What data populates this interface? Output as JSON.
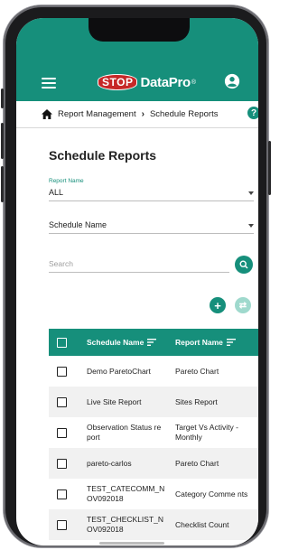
{
  "app": {
    "logo_stop": "STOP",
    "logo_text": "DataPro",
    "logo_reg": "®"
  },
  "breadcrumb": {
    "parent": "Report Management",
    "current": "Schedule Reports",
    "help": "?"
  },
  "page": {
    "title": "Schedule Reports"
  },
  "filters": {
    "report_name_label": "Report Name",
    "report_name_value": "ALL",
    "schedule_name_value": "Schedule Name",
    "search_placeholder": "Search"
  },
  "actions": {
    "add": "+",
    "swap": "⇄"
  },
  "table": {
    "headers": [
      "Schedule Name",
      "Report Name"
    ],
    "rows": [
      {
        "schedule": "Demo ParetoChart",
        "report": "Pareto Chart"
      },
      {
        "schedule": "Live Site Report",
        "report": "Sites Report"
      },
      {
        "schedule": "Observation Status re port",
        "report": "Target Vs Activity - Monthly"
      },
      {
        "schedule": "pareto-carlos",
        "report": "Pareto Chart"
      },
      {
        "schedule": "TEST_CATECOMM_N OV092018",
        "report": "Category Comme nts"
      },
      {
        "schedule": "TEST_CHECKLIST_N OV092018",
        "report": "Checklist Count"
      }
    ]
  },
  "colors": {
    "primary": "#168f7b",
    "accent_red": "#c62828"
  },
  "icons": [
    "menu-icon",
    "account-icon",
    "home-icon",
    "chevron-right-icon",
    "help-icon",
    "search-icon",
    "add-icon",
    "swap-icon",
    "sort-icon"
  ]
}
